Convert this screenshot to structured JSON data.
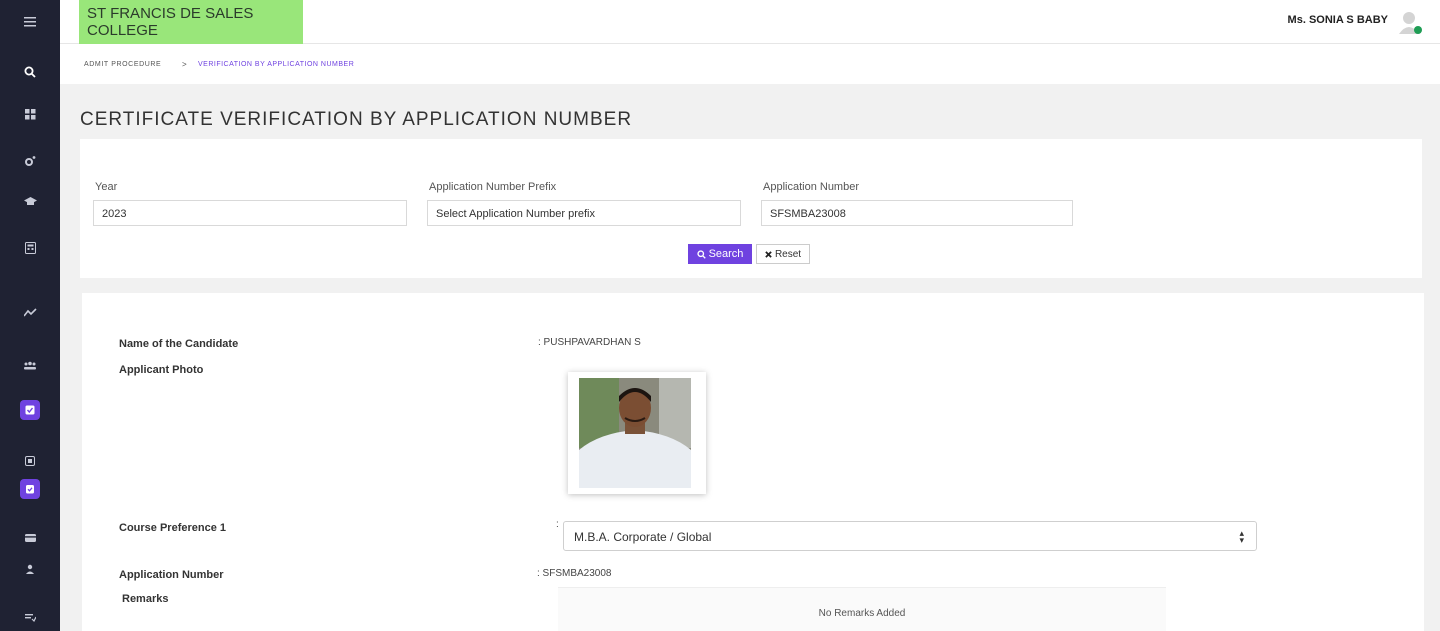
{
  "sidebar": {
    "items": [
      {
        "icon": "menu-icon"
      },
      {
        "icon": "search-icon"
      },
      {
        "icon": "dashboard-icon"
      },
      {
        "icon": "settings-icon"
      },
      {
        "icon": "graduation-cap-icon"
      },
      {
        "icon": "calculator-icon"
      },
      {
        "icon": "chart-line-icon"
      },
      {
        "icon": "users-icon"
      },
      {
        "icon": "checkbox-icon",
        "active": true
      },
      {
        "icon": "document-icon"
      },
      {
        "icon": "clipboard-check-icon",
        "active": true
      },
      {
        "icon": "card-icon"
      },
      {
        "icon": "user-icon"
      },
      {
        "icon": "list-filter-icon"
      }
    ],
    "accent": "#6f42e0",
    "background": "#1f2233"
  },
  "header": {
    "college_name": "ST FRANCIS DE SALES COLLEGE",
    "brand_color": "#99e67a",
    "user_name": "Ms. SONIA S BABY"
  },
  "breadcrumb": {
    "root": "ADMIT PROCEDURE",
    "separator": ">",
    "current": "VERIFICATION BY APPLICATION NUMBER"
  },
  "page": {
    "title": "CERTIFICATE VERIFICATION BY APPLICATION NUMBER"
  },
  "search": {
    "year_label": "Year",
    "year_value": "2023",
    "prefix_label": "Application Number Prefix",
    "prefix_value": "Select Application Number prefix",
    "appno_label": "Application Number",
    "appno_value": "SFSMBA23008",
    "search_label": "Search",
    "reset_label": "Reset"
  },
  "candidate": {
    "name_label": "Name of the Candidate",
    "name_value": ": PUSHPAVARDHAN S",
    "photo_label": "Applicant Photo",
    "course_label": "Course Preference 1",
    "course_colon": ":",
    "course_value": "M.B.A. Corporate / Global",
    "appno_label": "Application Number",
    "appno_value": ": SFSMBA23008",
    "remarks_label": "Remarks",
    "remarks_value": "No Remarks Added"
  }
}
